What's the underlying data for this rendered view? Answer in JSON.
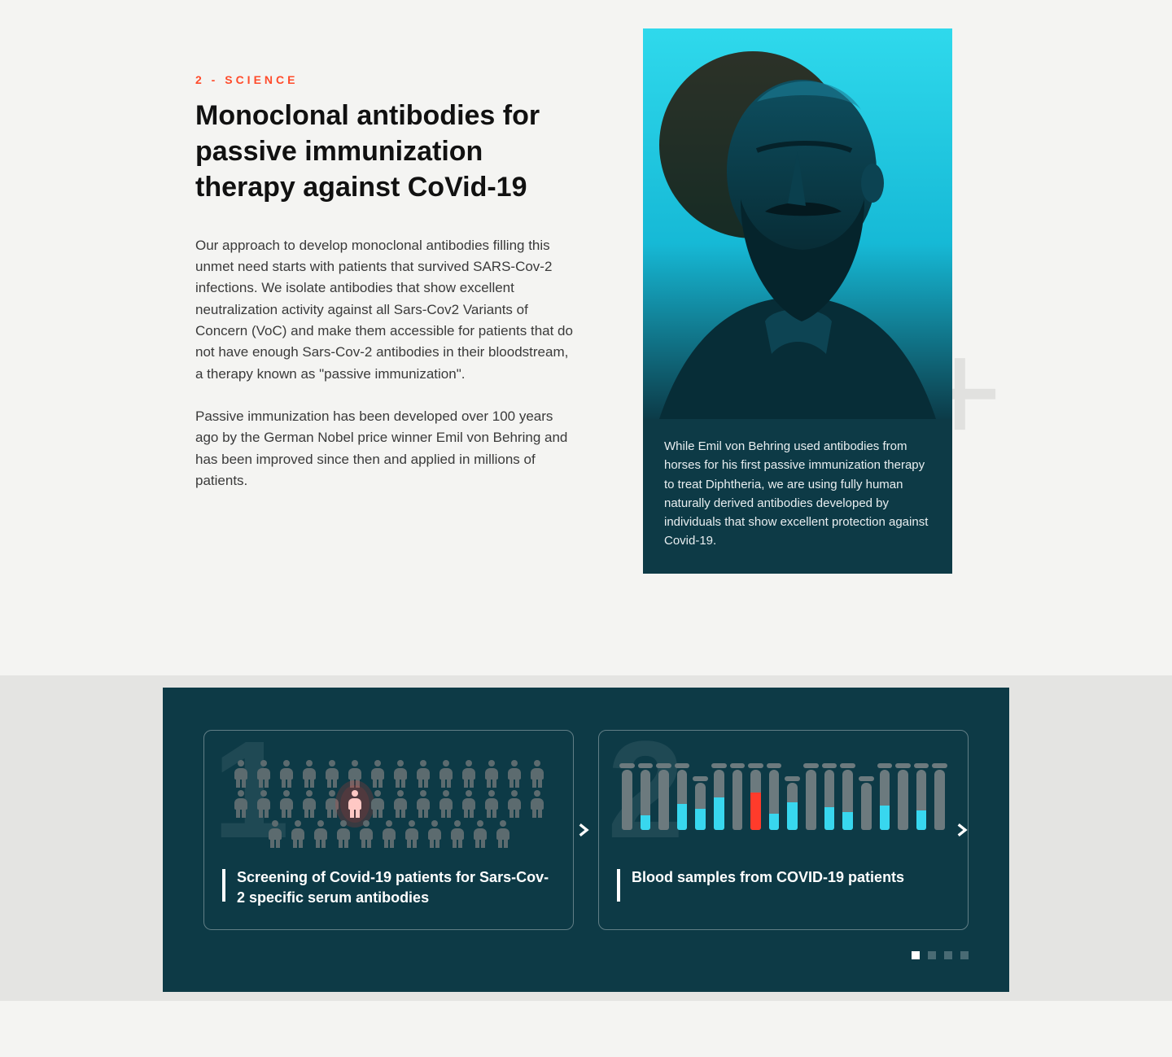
{
  "article": {
    "eyebrow": "2 - SCIENCE",
    "headline": "Monoclonal antibodies for passive immunization therapy against CoVid-19",
    "paragraph1": "Our approach to develop monoclonal antibodies filling this unmet need starts with patients that survived SARS-Cov-2 infections. We isolate antibodies that show excellent neutralization activity against all Sars-Cov2 Variants of Concern (VoC) and make them accessible for patients that do not have enough Sars-Cov-2 antibodies in their bloodstream, a therapy known as \"passive immunization\".",
    "paragraph2": "Passive immunization has been developed over 100 years ago by the German Nobel price winner Emil von Behring and has been improved since then and applied in millions of patients."
  },
  "imageCard": {
    "caption": "While Emil von Behring used antibodies from horses for his first passive immunization therapy to treat Diphtheria, we are using fully human naturally derived antibodies developed by individuals that show excellent protection against Covid-19."
  },
  "slider": {
    "slides": [
      {
        "number": "1",
        "title": "Screening of Covid-19 patients for Sars-Cov-2 specific serum antibodies"
      },
      {
        "number": "2",
        "title": "Blood samples from COVID-19 patients"
      }
    ],
    "activeDot": 0,
    "dotCount": 4
  }
}
